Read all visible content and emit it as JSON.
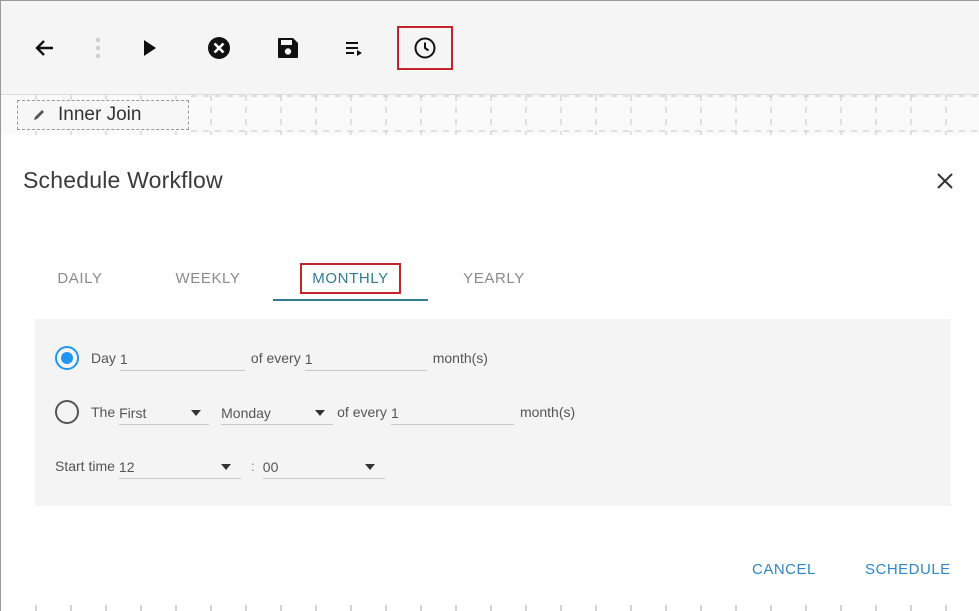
{
  "toolbar": {
    "icons": [
      "back-arrow-icon",
      "more-vertical-icon",
      "play-icon",
      "cancel-circle-icon",
      "save-icon",
      "list-run-icon",
      "clock-icon"
    ],
    "highlight_color": "#c0272d"
  },
  "canvas": {
    "node_label": "Inner Join",
    "node_icon": "pencil-icon"
  },
  "dialog": {
    "title": "Schedule Workflow",
    "tabs": [
      {
        "label": "DAILY",
        "active": false
      },
      {
        "label": "WEEKLY",
        "active": false
      },
      {
        "label": "MONTHLY",
        "active": true
      },
      {
        "label": "YEARLY",
        "active": false
      }
    ],
    "accent_color": "#2f7d95",
    "option1": {
      "selected": true,
      "prefix": "Day",
      "day_value": "1",
      "middle": "of every",
      "every_value": "1",
      "suffix": "month(s)"
    },
    "option2": {
      "selected": false,
      "prefix": "The",
      "ordinal_value": "First",
      "weekday_value": "Monday",
      "middle": "of every",
      "every_value": "1",
      "suffix": "month(s)"
    },
    "start_time": {
      "label": "Start time",
      "hour_value": "12",
      "separator": ":",
      "minute_value": "00"
    },
    "actions": {
      "cancel_label": "CANCEL",
      "schedule_label": "SCHEDULE"
    }
  }
}
